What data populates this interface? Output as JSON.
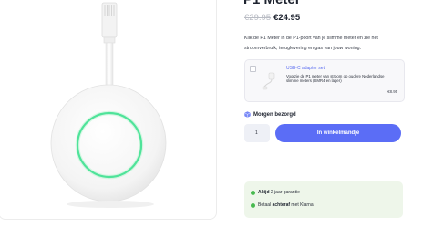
{
  "product": {
    "title": "P1 Meter",
    "price_old": "€29.95",
    "price_new": "€24.95",
    "description": "Klik de P1 Meter in de P1-poort van je slimme meter en zie het stroomverbruik, teruglevering en gas van jouw woning."
  },
  "upsell": {
    "title": "USB-C adapter set",
    "description": "Voorzie de P1 meter van stroom op oudere Nederlandse slimme meters (SMR4 en lager)",
    "price": "€8.95"
  },
  "delivery": {
    "icon": "package-icon",
    "text": "Morgen bezorgd"
  },
  "cart": {
    "quantity": "1",
    "button_label": "In winkelmandje"
  },
  "usps": [
    {
      "bold": "Altijd",
      "text": " 2 jaar garantie"
    },
    {
      "prefix": "Betaal ",
      "bold": "achteraf",
      "text": " met Klarna"
    }
  ],
  "colors": {
    "accent": "#5b6df6",
    "device_ring": "#4fe39a",
    "usp_background": "#eef6ea",
    "check": "#47b94f"
  }
}
